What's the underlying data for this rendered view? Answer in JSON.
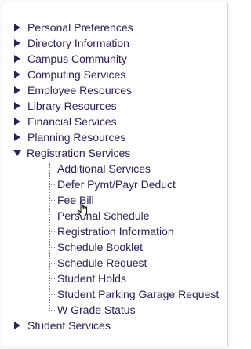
{
  "menu": {
    "top_before": [
      {
        "label": "Personal Preferences"
      },
      {
        "label": "Directory Information"
      },
      {
        "label": "Campus Community"
      },
      {
        "label": "Computing Services"
      },
      {
        "label": "Employee Resources"
      },
      {
        "label": "Library Resources"
      },
      {
        "label": "Financial Services"
      },
      {
        "label": "Planning Resources"
      }
    ],
    "expanded": {
      "label": "Registration Services",
      "children": [
        {
          "label": "Additional Services"
        },
        {
          "label": "Defer Pymt/Payr Deduct"
        },
        {
          "label": "Fee Bill"
        },
        {
          "label": "Personal Schedule"
        },
        {
          "label": "Registration Information"
        },
        {
          "label": "Schedule Booklet"
        },
        {
          "label": "Schedule Request"
        },
        {
          "label": "Student Holds"
        },
        {
          "label": "Student Parking Garage Request"
        },
        {
          "label": "W Grade Status"
        }
      ]
    },
    "top_after": [
      {
        "label": "Student Services"
      }
    ]
  },
  "colors": {
    "link": "#2e2056",
    "tree_line": "#7a7a7a"
  },
  "hovered_item": "Fee Bill",
  "cursor": "hand-pointer-icon"
}
